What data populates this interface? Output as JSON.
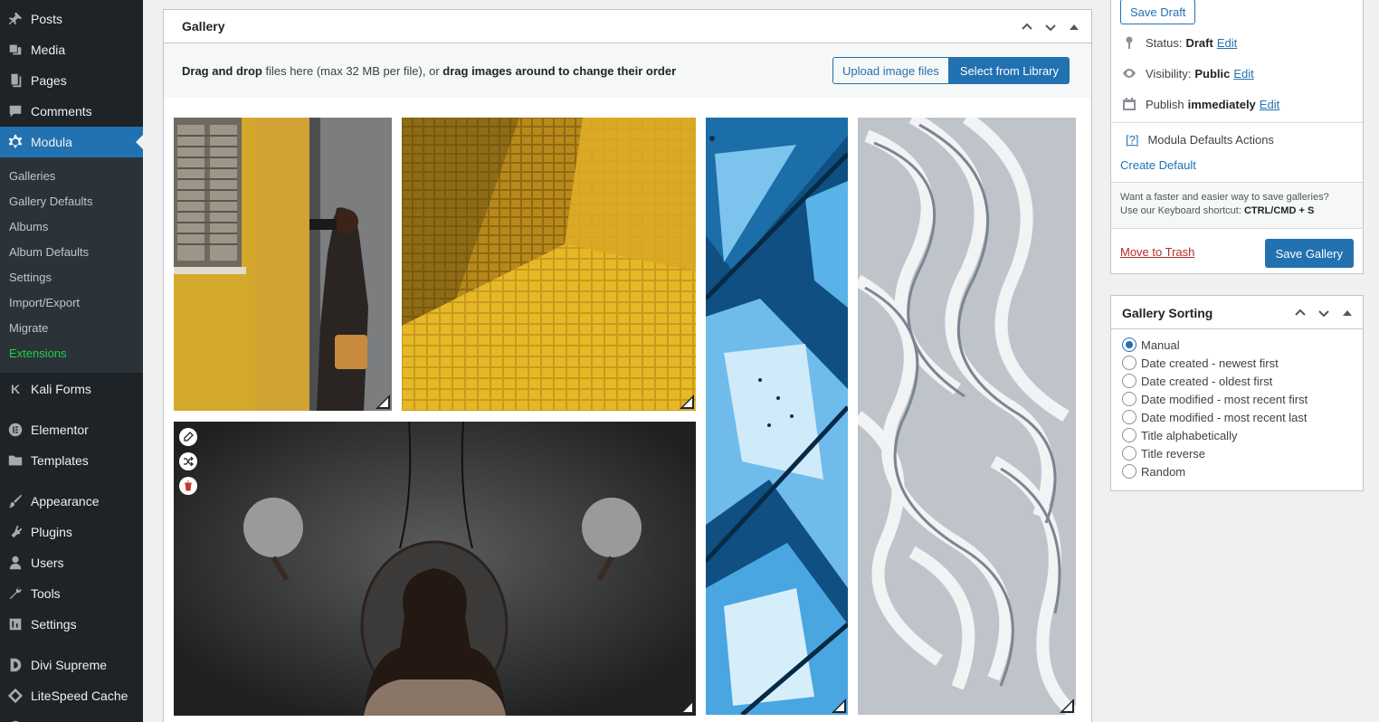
{
  "sidebar": {
    "top_items": [
      {
        "label": "Posts",
        "icon": "pushpin-icon"
      },
      {
        "label": "Media",
        "icon": "media-icon"
      },
      {
        "label": "Pages",
        "icon": "pages-icon"
      },
      {
        "label": "Comments",
        "icon": "comments-icon"
      },
      {
        "label": "Modula",
        "icon": "gear-icon"
      }
    ],
    "submenu": [
      "Galleries",
      "Gallery Defaults",
      "Albums",
      "Album Defaults",
      "Settings",
      "Import/Export",
      "Migrate",
      "Extensions"
    ],
    "bottom_items": [
      {
        "label": "Kali Forms",
        "icon": "kali-forms-icon"
      },
      {
        "label": "Elementor",
        "icon": "elementor-icon"
      },
      {
        "label": "Templates",
        "icon": "folder-icon"
      },
      {
        "label": "Appearance",
        "icon": "paintbrush-icon"
      },
      {
        "label": "Plugins",
        "icon": "plugin-icon"
      },
      {
        "label": "Users",
        "icon": "user-icon"
      },
      {
        "label": "Tools",
        "icon": "wrench-icon"
      },
      {
        "label": "Settings",
        "icon": "settings-icon"
      },
      {
        "label": "Divi Supreme",
        "icon": "divi-icon"
      },
      {
        "label": "LiteSpeed Cache",
        "icon": "litespeed-icon"
      }
    ],
    "accent_color": "#2271b1",
    "extension_color": "#1ed14b"
  },
  "gallery": {
    "title": "Gallery",
    "upload_text_bold_1": "Drag and drop",
    "upload_text_mid": "files here (max 32 MB per file), or",
    "upload_text_bold_2": "drag images around to change their order",
    "upload_button": "Upload image files",
    "library_button": "Select from Library",
    "images": [
      {
        "name": "woman-with-binoculars"
      },
      {
        "name": "yellow-tiles"
      },
      {
        "name": "blue-glass-ceiling"
      },
      {
        "name": "white-curved-facade"
      },
      {
        "name": "person-with-mirror-lamps"
      }
    ]
  },
  "publish": {
    "save_draft": "Save Draft",
    "status_label": "Status:",
    "status_value": "Draft",
    "visibility_label": "Visibility:",
    "visibility_value": "Public",
    "publish_label": "Publish",
    "publish_value": "immediately",
    "edit": "Edit",
    "help_link": "[?]",
    "defaults_title": "Modula Defaults Actions",
    "create_default": "Create Default",
    "tip_line1": "Want a faster and easier way to save galleries?",
    "tip_line2": "Use our Keyboard shortcut:",
    "tip_shortcut": "CTRL/CMD + S",
    "trash": "Move to Trash",
    "save_gallery": "Save Gallery"
  },
  "sorting": {
    "title": "Gallery Sorting",
    "options": [
      "Manual",
      "Date created - newest first",
      "Date created - oldest first",
      "Date modified - most recent first",
      "Date modified - most recent last",
      "Title alphabetically",
      "Title reverse",
      "Random"
    ],
    "selected": "Manual"
  }
}
